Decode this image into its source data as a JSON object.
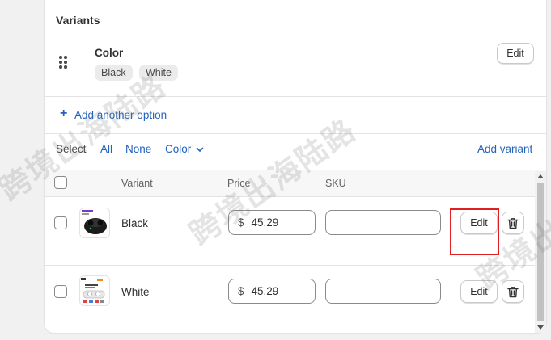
{
  "variants": {
    "title": "Variants",
    "option": {
      "name": "Color",
      "values": [
        "Black",
        "White"
      ],
      "edit_label": "Edit"
    },
    "add_option_label": "Add another option",
    "select": {
      "label": "Select",
      "all": "All",
      "none": "None",
      "color": "Color"
    },
    "add_variant_label": "Add variant",
    "table": {
      "headers": {
        "variant": "Variant",
        "price": "Price",
        "sku": "SKU"
      },
      "rows": [
        {
          "name": "Black",
          "currency": "$",
          "price": "45.29",
          "sku": "",
          "edit_label": "Edit",
          "highlighted": true
        },
        {
          "name": "White",
          "currency": "$",
          "price": "45.29",
          "sku": "",
          "edit_label": "Edit",
          "highlighted": false
        }
      ]
    }
  },
  "watermark": "跨境出海陆路",
  "icons": {
    "drag": "drag-handle-icon",
    "plus": "plus-icon",
    "chevron": "chevron-down-icon",
    "trash": "trash-icon"
  },
  "colors": {
    "link": "#2463bc",
    "highlight": "#e02020",
    "chip_bg": "#ebebeb"
  }
}
